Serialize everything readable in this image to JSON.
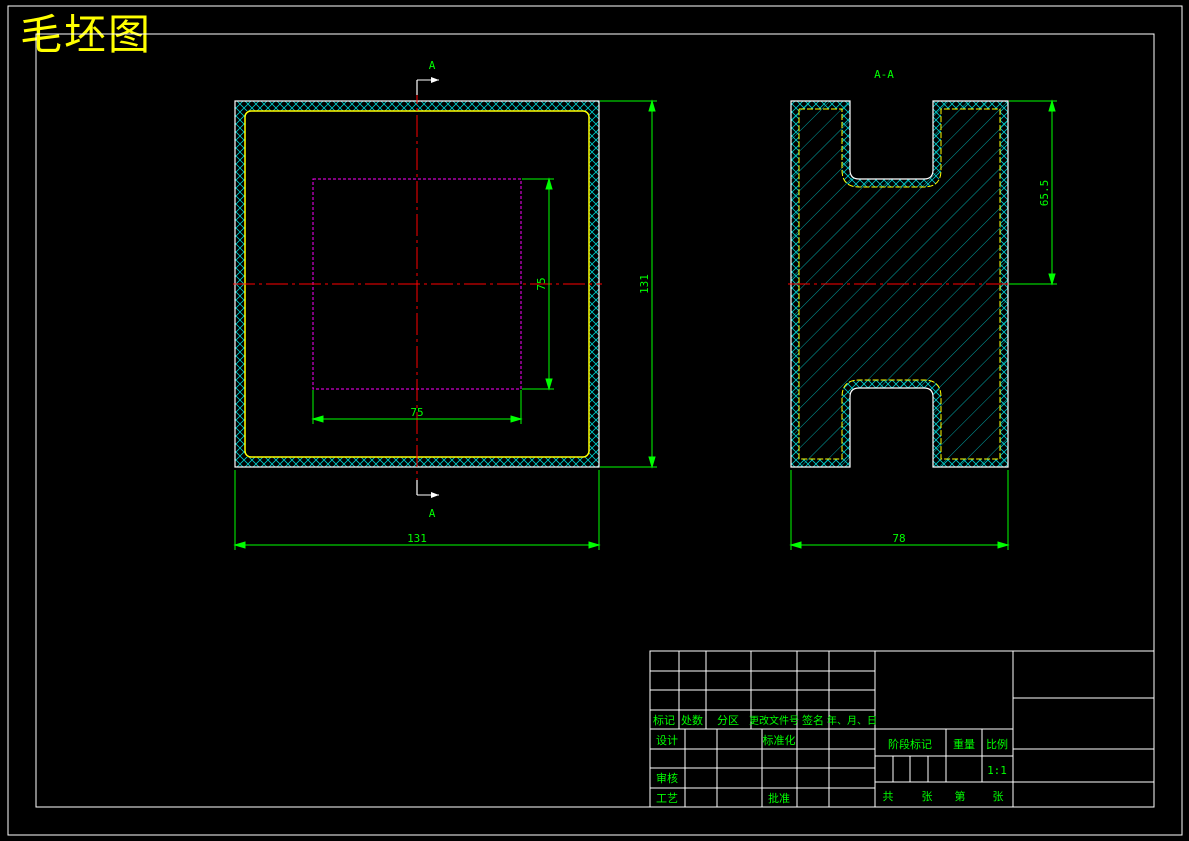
{
  "title": "毛坯图",
  "colors": {
    "background": "#000000",
    "frame": "#ffffff",
    "outline": "#ffffff",
    "dimension": "#00ff00",
    "centerline": "#ff0000",
    "hatch": "#00cccc",
    "blank_outline": "#ffff00",
    "inner_square": "#ff00ff",
    "title_text": "#ffff00",
    "table_text": "#00ff00"
  },
  "front_view": {
    "section_mark_top": "A",
    "section_mark_bottom": "A",
    "dim_width": "131",
    "dim_height": "131",
    "dim_inner_width": "75",
    "dim_inner_height": "75"
  },
  "section_view": {
    "label": "A-A",
    "dim_width": "78",
    "dim_slot_depth": "65.5"
  },
  "title_block": {
    "header_mark": "标记",
    "header_count": "处数",
    "header_zone": "分区",
    "header_doc": "更改文件号",
    "header_sign": "签名",
    "header_date": "年、月、日",
    "design": "设计",
    "standardize": "标准化",
    "review": "审核",
    "process": "工艺",
    "approve": "批准",
    "stage_mark": "阶段标记",
    "weight": "重量",
    "scale": "比例",
    "scale_value": "1:1",
    "total": "共",
    "sheets": "张",
    "number": "第",
    "sheet": "张"
  }
}
